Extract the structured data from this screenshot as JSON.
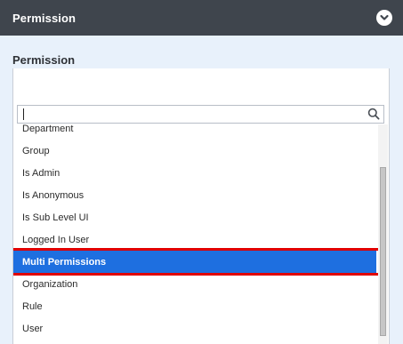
{
  "header": {
    "title": "Permission",
    "collapse_icon": "chevron-circle-down-icon"
  },
  "field": {
    "label": "Permission",
    "value": ""
  },
  "dropdown": {
    "search_value": "",
    "search_icon": "search-icon",
    "options": [
      {
        "label": "Department",
        "selected": false
      },
      {
        "label": "Group",
        "selected": false
      },
      {
        "label": "Is Admin",
        "selected": false
      },
      {
        "label": "Is Anonymous",
        "selected": false
      },
      {
        "label": "Is Sub Level UI",
        "selected": false
      },
      {
        "label": "Logged In User",
        "selected": false
      },
      {
        "label": "Multi Permissions",
        "selected": true
      },
      {
        "label": "Organization",
        "selected": false
      },
      {
        "label": "Rule",
        "selected": false
      },
      {
        "label": "User",
        "selected": false
      }
    ]
  },
  "colors": {
    "header_bg": "#3f454d",
    "body_bg": "#e8f1fb",
    "selected_bg": "#1e6fe0",
    "highlight_border": "#e00000"
  }
}
